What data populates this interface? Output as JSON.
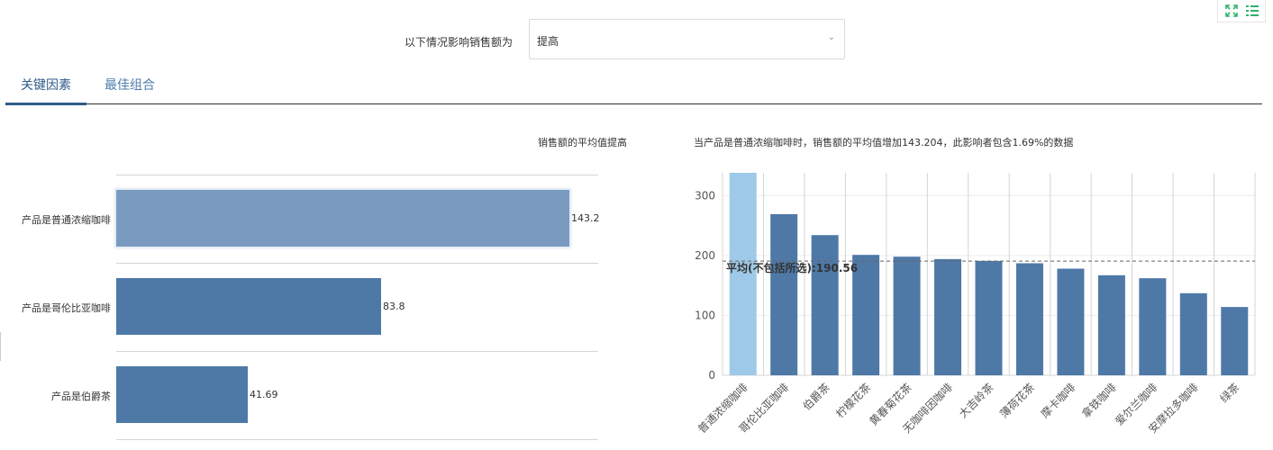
{
  "filter": {
    "label": "以下情况影响销售额为",
    "value": "提高"
  },
  "tabs": [
    {
      "label": "关键因素"
    },
    {
      "label": "最佳组合"
    }
  ],
  "left_panel": {
    "heading": "销售额的平均值提高"
  },
  "right_panel": {
    "heading": "当产品是普通浓缩咖啡时，销售额的平均值增加143.204，此影响者包含1.69%的数据"
  },
  "icons": {
    "expand": "expand-icon",
    "list": "list-icon"
  },
  "colors": {
    "bar": "#4e79a7",
    "selected_bar": "#7a9bbf",
    "highlight": "#9fc9e8",
    "accent": "#2f5b8a",
    "icon": "#2db36b"
  },
  "chart_data": [
    {
      "type": "bar",
      "orientation": "horizontal",
      "categories": [
        "产品是普通浓缩咖啡",
        "产品是哥伦比亚咖啡",
        "产品是伯爵茶"
      ],
      "values": [
        143.2,
        83.8,
        41.69
      ],
      "value_labels": [
        "143.2",
        "83.8",
        "41.69"
      ],
      "selected_index": 0
    },
    {
      "type": "bar",
      "categories": [
        "普通浓缩咖啡",
        "哥伦比亚咖啡",
        "伯爵茶",
        "柠檬花茶",
        "黄春菊花茶",
        "无咖啡因咖啡",
        "大吉岭茶",
        "薄荷花茶",
        "摩卡咖啡",
        "拿铁咖啡",
        "爱尔兰咖啡",
        "安摩拉多咖啡",
        "绿茶"
      ],
      "values": [
        338,
        269,
        234,
        201,
        198,
        194,
        191,
        187,
        178,
        167,
        162,
        137,
        114
      ],
      "highlight_index": 0,
      "ylim": [
        0,
        338
      ],
      "yticks": [
        "0",
        "100",
        "200",
        "300"
      ],
      "reference_line": {
        "value": 190.56,
        "label": "平均(不包括所选):190.56"
      },
      "grid": true
    }
  ]
}
